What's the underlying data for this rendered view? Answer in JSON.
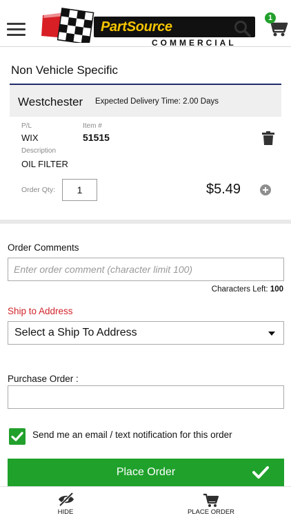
{
  "header": {
    "logo_brand": "PartSource",
    "logo_sub": "COMMERCIAL",
    "cart_count": "1",
    "accent_color": "#22a02c"
  },
  "order": {
    "section_title": "Non Vehicle Specific",
    "store": "Westchester",
    "delivery_text": "Expected Delivery Time: 2.00 Days",
    "pl_label": "P/L",
    "pl_value": "WIX",
    "item_label": "Item #",
    "item_value": "51515",
    "desc_label": "Description",
    "desc_value": "OIL FILTER",
    "qty_label": "Order Qty:",
    "qty_value": "1",
    "price": "$5.49"
  },
  "form": {
    "comments_label": "Order Comments",
    "comments_placeholder": "Enter order comment (character limit 100)",
    "chars_left_label": "Characters Left:",
    "chars_left_value": "100",
    "ship_label": "Ship to Address",
    "ship_selected": "Select a Ship To Address",
    "po_label": "Purchase Order :",
    "po_value": "",
    "notify_label": "Send me an email / text notification for this order",
    "notify_checked": true,
    "place_order_label": "Place Order"
  },
  "bottom_nav": {
    "hide_label": "HIDE",
    "place_order_label": "PLACE ORDER"
  },
  "icons": [
    "menu-icon",
    "search-icon",
    "cart-icon",
    "trash-icon",
    "plus-icon",
    "chevron-down-icon",
    "check-icon",
    "hide-icon",
    "cart-icon"
  ]
}
